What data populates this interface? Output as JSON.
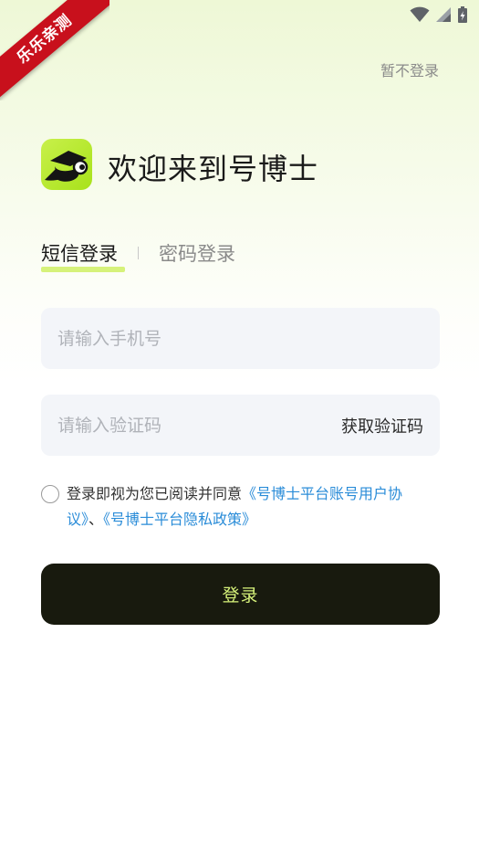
{
  "ribbon": {
    "text": "乐乐亲测"
  },
  "header": {
    "skip_login": "暂不登录"
  },
  "brand": {
    "welcome": "欢迎来到号博士",
    "logo_color": "#b5e82c"
  },
  "tabs": [
    {
      "label": "短信登录",
      "active": true
    },
    {
      "label": "密码登录",
      "active": false
    }
  ],
  "form": {
    "phone": {
      "placeholder": "请输入手机号",
      "value": ""
    },
    "code": {
      "placeholder": "请输入验证码",
      "value": "",
      "get_code_label": "获取验证码"
    },
    "agreement": {
      "prefix": "登录即视为您已阅读并同意",
      "link1": "《号博士平台账号用户协议》",
      "separator": "、",
      "link2": "《号博士平台隐私政策》"
    },
    "login_label": "登录"
  },
  "colors": {
    "accent": "#d6f27a",
    "button_bg": "#181a0e",
    "link": "#2a8cd8"
  }
}
